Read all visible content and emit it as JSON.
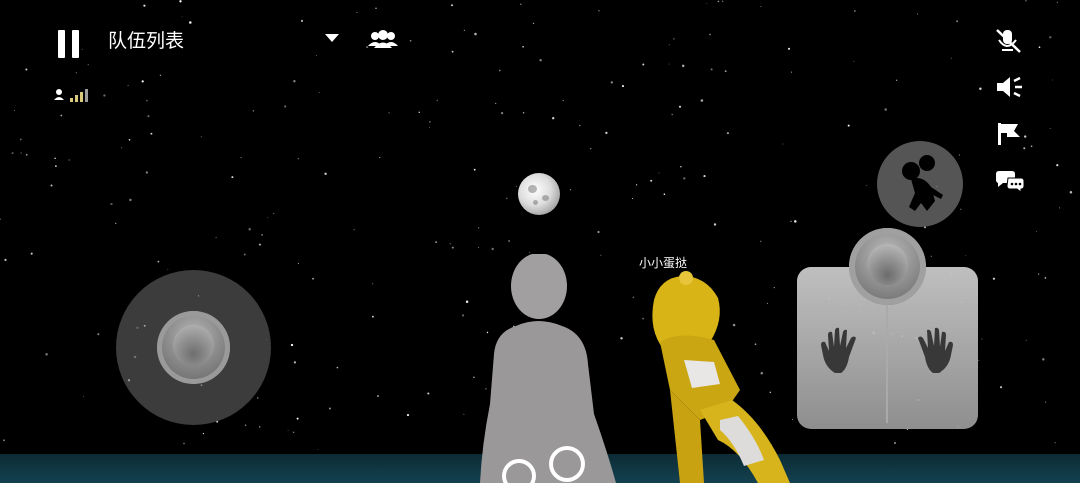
{
  "hud": {
    "pause_icon": "pause-icon",
    "team_dropdown_label": "队伍列表",
    "dropdown_icon": "caret-down-icon",
    "team_icon": "team-members-icon",
    "connection": {
      "icon": "player-signal-icon",
      "signal_bars": 4
    },
    "right_toolbar": [
      {
        "icon": "mic-muted-icon"
      },
      {
        "icon": "speaker-icon"
      },
      {
        "icon": "flag-icon"
      },
      {
        "icon": "chat-bubbles-icon"
      }
    ]
  },
  "world": {
    "player_name": "小小蛋挞",
    "moon_icon": "moon",
    "background": "starry-night-sky"
  },
  "controls": {
    "move_joystick": "movement-joystick",
    "gesture_button": "dance-pose-icon",
    "hands_pad": {
      "left": "left-hand-icon",
      "right": "right-hand-icon"
    }
  },
  "colors": {
    "sky": "#000000",
    "ground": "#134150",
    "avatar_gray": "#9b9999",
    "avatar_yellow": "#d8b417",
    "ui_white": "#ffffff"
  }
}
